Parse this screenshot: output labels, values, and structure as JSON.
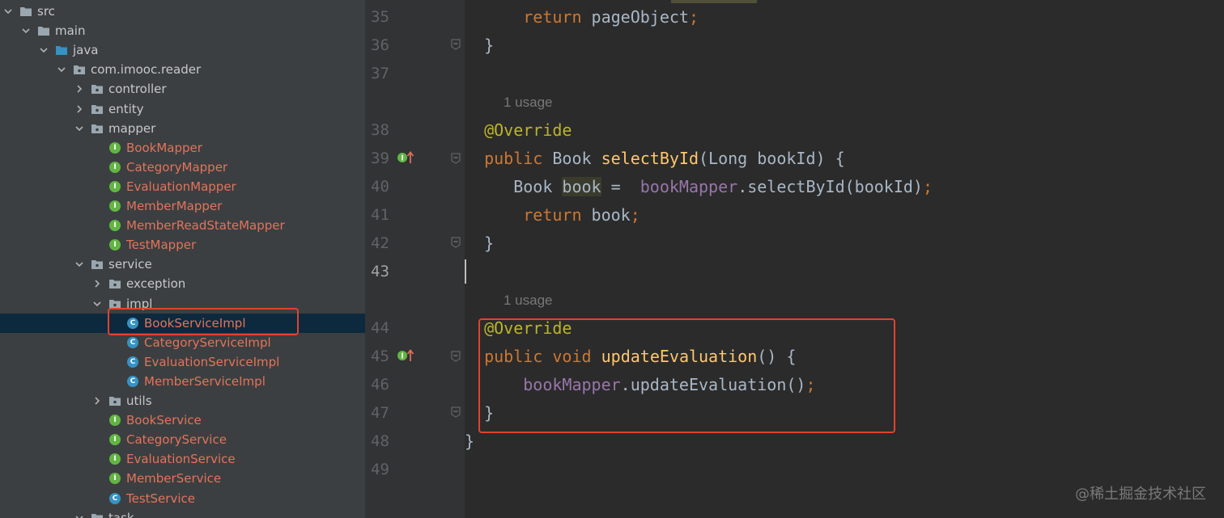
{
  "project_tree": {
    "nodes": [
      {
        "label": "src",
        "kind": "dir",
        "indent": 0,
        "arrow": "down"
      },
      {
        "label": "main",
        "kind": "dir",
        "indent": 1,
        "arrow": "down"
      },
      {
        "label": "java",
        "kind": "src-dir",
        "indent": 2,
        "arrow": "down"
      },
      {
        "label": "com.imooc.reader",
        "kind": "pkg",
        "indent": 3,
        "arrow": "down"
      },
      {
        "label": "controller",
        "kind": "pkg",
        "indent": 4,
        "arrow": "right"
      },
      {
        "label": "entity",
        "kind": "pkg",
        "indent": 4,
        "arrow": "right"
      },
      {
        "label": "mapper",
        "kind": "pkg",
        "indent": 4,
        "arrow": "down"
      },
      {
        "label": "BookMapper",
        "kind": "iface",
        "indent": 5,
        "arrow": "none"
      },
      {
        "label": "CategoryMapper",
        "kind": "iface",
        "indent": 5,
        "arrow": "none"
      },
      {
        "label": "EvaluationMapper",
        "kind": "iface",
        "indent": 5,
        "arrow": "none"
      },
      {
        "label": "MemberMapper",
        "kind": "iface",
        "indent": 5,
        "arrow": "none"
      },
      {
        "label": "MemberReadStateMapper",
        "kind": "iface",
        "indent": 5,
        "arrow": "none"
      },
      {
        "label": "TestMapper",
        "kind": "iface",
        "indent": 5,
        "arrow": "none"
      },
      {
        "label": "service",
        "kind": "pkg",
        "indent": 4,
        "arrow": "down"
      },
      {
        "label": "exception",
        "kind": "pkg",
        "indent": 5,
        "arrow": "right"
      },
      {
        "label": "impl",
        "kind": "pkg",
        "indent": 5,
        "arrow": "down"
      },
      {
        "label": "BookServiceImpl",
        "kind": "cls",
        "indent": 6,
        "arrow": "none",
        "selected": true
      },
      {
        "label": "CategoryServiceImpl",
        "kind": "cls",
        "indent": 6,
        "arrow": "none"
      },
      {
        "label": "EvaluationServiceImpl",
        "kind": "cls",
        "indent": 6,
        "arrow": "none"
      },
      {
        "label": "MemberServiceImpl",
        "kind": "cls",
        "indent": 6,
        "arrow": "none"
      },
      {
        "label": "utils",
        "kind": "pkg",
        "indent": 5,
        "arrow": "right"
      },
      {
        "label": "BookService",
        "kind": "iface",
        "indent": 5,
        "arrow": "none"
      },
      {
        "label": "CategoryService",
        "kind": "iface",
        "indent": 5,
        "arrow": "none"
      },
      {
        "label": "EvaluationService",
        "kind": "iface",
        "indent": 5,
        "arrow": "none"
      },
      {
        "label": "MemberService",
        "kind": "iface",
        "indent": 5,
        "arrow": "none"
      },
      {
        "label": "TestService",
        "kind": "cls",
        "indent": 5,
        "arrow": "none"
      },
      {
        "label": "task",
        "kind": "pkg",
        "indent": 4,
        "arrow": "down"
      }
    ],
    "interface_badge": "I",
    "class_badge": "C"
  },
  "editor": {
    "current_line": "43",
    "usage_hint": "1 usage",
    "lines": [
      {
        "num": "35",
        "tokens": [
          [
            "      ",
            ""
          ],
          [
            "return",
            "kw"
          ],
          [
            " pageObject",
            ""
          ],
          [
            ";",
            "semi"
          ]
        ]
      },
      {
        "num": "36",
        "tokens": [
          [
            "  }",
            ""
          ]
        ]
      },
      {
        "num": "37",
        "tokens": []
      },
      {
        "num": "38",
        "tokens": [
          [
            "  ",
            ""
          ],
          [
            "@Override",
            "an"
          ]
        ]
      },
      {
        "num": "39",
        "tokens": [
          [
            "  ",
            ""
          ],
          [
            "public",
            "kw"
          ],
          [
            " Book ",
            ""
          ],
          [
            "selectById",
            "fn"
          ],
          [
            "(Long bookId) {",
            ""
          ]
        ]
      },
      {
        "num": "40",
        "tokens": [
          [
            "     Book ",
            ""
          ],
          [
            "book",
            "hl"
          ],
          [
            " =  ",
            ""
          ],
          [
            "bookMapper",
            "fld"
          ],
          [
            ".selectById(bookId)",
            ""
          ],
          [
            ";",
            "semi"
          ]
        ]
      },
      {
        "num": "41",
        "tokens": [
          [
            "      ",
            ""
          ],
          [
            "return",
            "kw"
          ],
          [
            " book",
            ""
          ],
          [
            ";",
            "semi"
          ]
        ]
      },
      {
        "num": "42",
        "tokens": [
          [
            "  }",
            ""
          ]
        ]
      },
      {
        "num": "43",
        "tokens": []
      },
      {
        "num": "44",
        "tokens": [
          [
            "  ",
            ""
          ],
          [
            "@Override",
            "an"
          ]
        ]
      },
      {
        "num": "45",
        "tokens": [
          [
            "  ",
            ""
          ],
          [
            "public",
            "kw"
          ],
          [
            " ",
            ""
          ],
          [
            "void",
            "kw"
          ],
          [
            " ",
            ""
          ],
          [
            "updateEvaluation",
            "fn"
          ],
          [
            "() {",
            ""
          ]
        ]
      },
      {
        "num": "46",
        "tokens": [
          [
            "      ",
            ""
          ],
          [
            "bookMapper",
            "fld"
          ],
          [
            ".updateEvaluation()",
            ""
          ],
          [
            ";",
            "semi"
          ]
        ]
      },
      {
        "num": "47",
        "tokens": [
          [
            "  }",
            ""
          ]
        ]
      },
      {
        "num": "48",
        "tokens": [
          [
            "}",
            ""
          ]
        ]
      },
      {
        "num": "49",
        "tokens": []
      }
    ]
  },
  "watermark": "@稀土掘金技术社区",
  "colors": {
    "highlight_box": "#e0432f",
    "tree_bg": "#3c3f41",
    "editor_bg": "#2b2b2b",
    "selection_bg": "#0d293e"
  }
}
